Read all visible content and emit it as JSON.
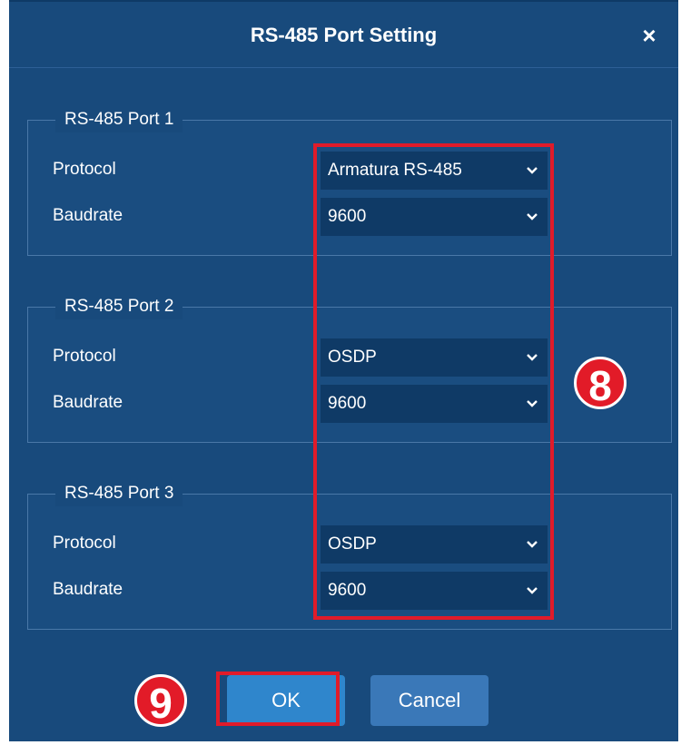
{
  "dialog": {
    "title": "RS-485 Port Setting",
    "close_glyph": "×"
  },
  "ports": [
    {
      "legend": "RS-485 Port 1",
      "protocol_label": "Protocol",
      "protocol_value": "Armatura RS-485",
      "baudrate_label": "Baudrate",
      "baudrate_value": "9600"
    },
    {
      "legend": "RS-485 Port 2",
      "protocol_label": "Protocol",
      "protocol_value": "OSDP",
      "baudrate_label": "Baudrate",
      "baudrate_value": "9600"
    },
    {
      "legend": "RS-485 Port 3",
      "protocol_label": "Protocol",
      "protocol_value": "OSDP",
      "baudrate_label": "Baudrate",
      "baudrate_value": "9600"
    }
  ],
  "buttons": {
    "ok": "OK",
    "cancel": "Cancel"
  },
  "callouts": {
    "selects": "8",
    "ok": "9"
  },
  "colors": {
    "dialog_bg": "#184a7c",
    "select_bg": "#0f3a66",
    "accent": "#2f86cc",
    "callout_red": "#e21b28"
  },
  "icons": {
    "close": "close-icon",
    "dropdown": "chevron-down-icon"
  }
}
